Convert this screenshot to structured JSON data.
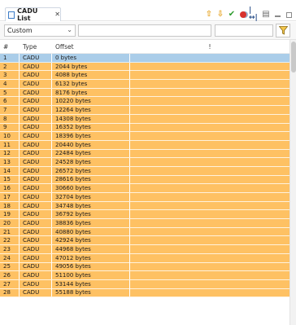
{
  "tab": {
    "title": "CADU List",
    "close_glyph": "✕",
    "icon": "table-icon"
  },
  "toolbar": {
    "icons": [
      "arrow-up-icon",
      "arrow-down-icon",
      "check-icon",
      "record-icon",
      "fit-columns-icon",
      "print-icon",
      "minimize-icon",
      "maximize-icon"
    ]
  },
  "filter": {
    "mode": "Custom",
    "text_value": "",
    "second_value": "",
    "arrow_glyph": "⌄"
  },
  "columns": {
    "num": "#",
    "type": "Type",
    "offset": "Offset",
    "mark": "!"
  },
  "rows": [
    {
      "num": "1",
      "type": "CADU",
      "offset": "0 bytes",
      "selected": true
    },
    {
      "num": "2",
      "type": "CADU",
      "offset": "2044 bytes"
    },
    {
      "num": "3",
      "type": "CADU",
      "offset": "4088 bytes"
    },
    {
      "num": "4",
      "type": "CADU",
      "offset": "6132 bytes"
    },
    {
      "num": "5",
      "type": "CADU",
      "offset": "8176 bytes"
    },
    {
      "num": "6",
      "type": "CADU",
      "offset": "10220 bytes"
    },
    {
      "num": "7",
      "type": "CADU",
      "offset": "12264 bytes"
    },
    {
      "num": "8",
      "type": "CADU",
      "offset": "14308 bytes"
    },
    {
      "num": "9",
      "type": "CADU",
      "offset": "16352 bytes"
    },
    {
      "num": "10",
      "type": "CADU",
      "offset": "18396 bytes"
    },
    {
      "num": "11",
      "type": "CADU",
      "offset": "20440 bytes"
    },
    {
      "num": "12",
      "type": "CADU",
      "offset": "22484 bytes"
    },
    {
      "num": "13",
      "type": "CADU",
      "offset": "24528 bytes"
    },
    {
      "num": "14",
      "type": "CADU",
      "offset": "26572 bytes"
    },
    {
      "num": "15",
      "type": "CADU",
      "offset": "28616 bytes"
    },
    {
      "num": "16",
      "type": "CADU",
      "offset": "30660 bytes"
    },
    {
      "num": "17",
      "type": "CADU",
      "offset": "32704 bytes"
    },
    {
      "num": "18",
      "type": "CADU",
      "offset": "34748 bytes"
    },
    {
      "num": "19",
      "type": "CADU",
      "offset": "36792 bytes"
    },
    {
      "num": "20",
      "type": "CADU",
      "offset": "38836 bytes"
    },
    {
      "num": "21",
      "type": "CADU",
      "offset": "40880 bytes"
    },
    {
      "num": "22",
      "type": "CADU",
      "offset": "42924 bytes"
    },
    {
      "num": "23",
      "type": "CADU",
      "offset": "44968 bytes"
    },
    {
      "num": "24",
      "type": "CADU",
      "offset": "47012 bytes"
    },
    {
      "num": "25",
      "type": "CADU",
      "offset": "49056 bytes"
    },
    {
      "num": "26",
      "type": "CADU",
      "offset": "51100 bytes"
    },
    {
      "num": "27",
      "type": "CADU",
      "offset": "53144 bytes"
    },
    {
      "num": "28",
      "type": "CADU",
      "offset": "55188 bytes"
    }
  ],
  "colors": {
    "row_bg": "#fec163",
    "selected_bg": "#aacde9",
    "accent": "#3d7dc8"
  }
}
